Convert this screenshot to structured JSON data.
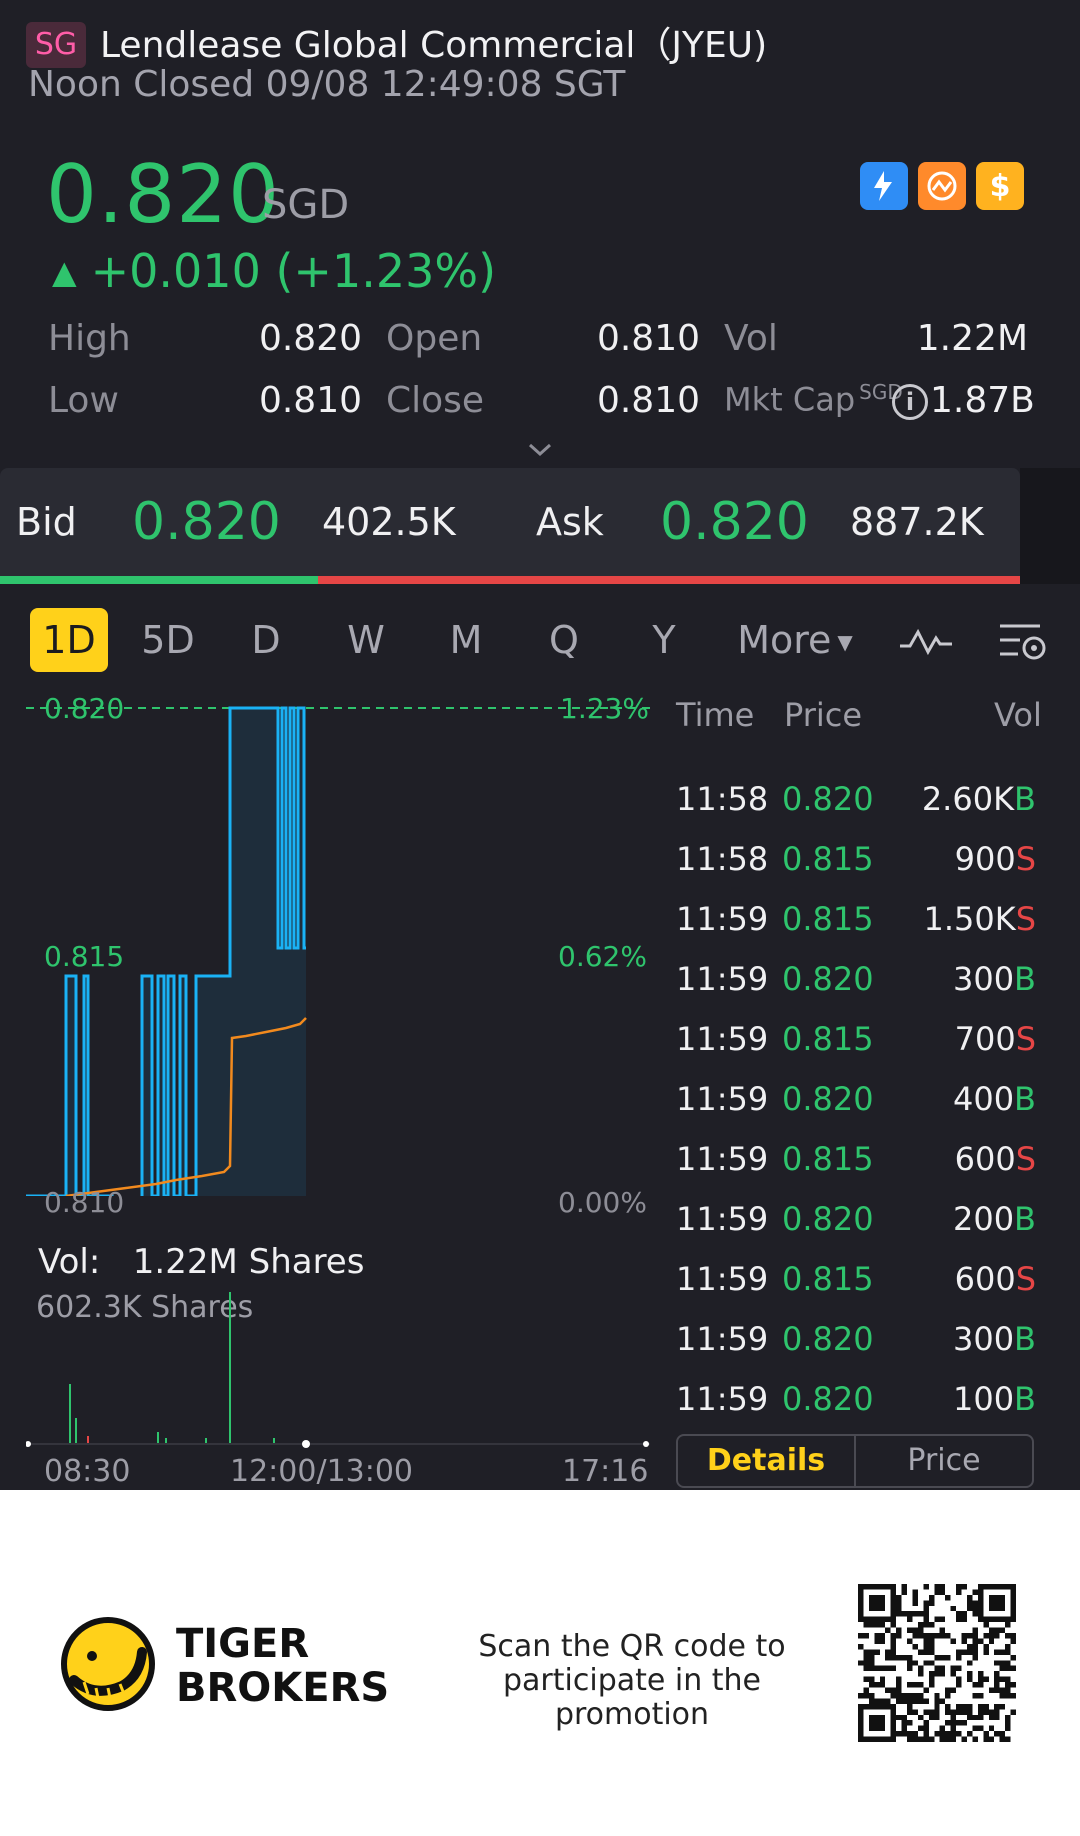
{
  "header": {
    "market_badge": "SG",
    "title": "Lendlease Global Commercial（JYEU)",
    "status": "Noon Closed 09/08 12:49:08 SGT"
  },
  "quote": {
    "price": "0.820",
    "currency": "SGD",
    "change": "+0.010 (+1.23%)",
    "up_color": "#2fc46d",
    "down_color": "#e64646"
  },
  "quick_icons": [
    "lightning-icon",
    "options-icon",
    "dollar-icon"
  ],
  "stats": {
    "high_label": "High",
    "high_value": "0.820",
    "open_label": "Open",
    "open_value": "0.810",
    "vol_label": "Vol",
    "vol_value": "1.22M",
    "low_label": "Low",
    "low_value": "0.810",
    "close_label": "Close",
    "close_value": "0.810",
    "mktcap_label": "Mkt Cap",
    "mktcap_sup": "SGD",
    "mktcap_value": "1.87B"
  },
  "bidask": {
    "bid_label": "Bid",
    "bid_price": "0.820",
    "bid_size": "402.5K",
    "ask_label": "Ask",
    "ask_price": "0.820",
    "ask_size": "887.2K"
  },
  "tabs": {
    "items": [
      "1D",
      "5D",
      "D",
      "W",
      "M",
      "Q",
      "Y"
    ],
    "more": "More",
    "active": "1D"
  },
  "chart": {
    "price_high": "0.820",
    "price_mid": "0.815",
    "price_low": "0.810",
    "pct_high": "1.23%",
    "pct_mid": "0.62%",
    "pct_low": "0.00%",
    "line_color": "#1ab2f5",
    "avg_color": "#f28a1e",
    "vol_title_label": "Vol:",
    "vol_title_value": "1.22M Shares",
    "vol_max": "602.3K Shares",
    "time_start": "08:30",
    "time_mid": "12:00/13:00",
    "time_end": "17:16"
  },
  "tape": {
    "col_time": "Time",
    "col_price": "Price",
    "col_vol": "Vol",
    "rows": [
      {
        "time": "11:58",
        "price": "0.820",
        "vol": "2.60K",
        "side": "B"
      },
      {
        "time": "11:58",
        "price": "0.815",
        "vol": "900",
        "side": "S"
      },
      {
        "time": "11:59",
        "price": "0.815",
        "vol": "1.50K",
        "side": "S"
      },
      {
        "time": "11:59",
        "price": "0.820",
        "vol": "300",
        "side": "B"
      },
      {
        "time": "11:59",
        "price": "0.815",
        "vol": "700",
        "side": "S"
      },
      {
        "time": "11:59",
        "price": "0.820",
        "vol": "400",
        "side": "B"
      },
      {
        "time": "11:59",
        "price": "0.815",
        "vol": "600",
        "side": "S"
      },
      {
        "time": "11:59",
        "price": "0.820",
        "vol": "200",
        "side": "B"
      },
      {
        "time": "11:59",
        "price": "0.815",
        "vol": "600",
        "side": "S"
      },
      {
        "time": "11:59",
        "price": "0.820",
        "vol": "300",
        "side": "B"
      },
      {
        "time": "11:59",
        "price": "0.820",
        "vol": "100",
        "side": "B"
      }
    ],
    "tab_details": "Details",
    "tab_price": "Price"
  },
  "footer": {
    "brand_line1": "TIGER",
    "brand_line2": "BROKERS",
    "promo_line1": "Scan the QR code to",
    "promo_line2": "participate in the promotion"
  }
}
